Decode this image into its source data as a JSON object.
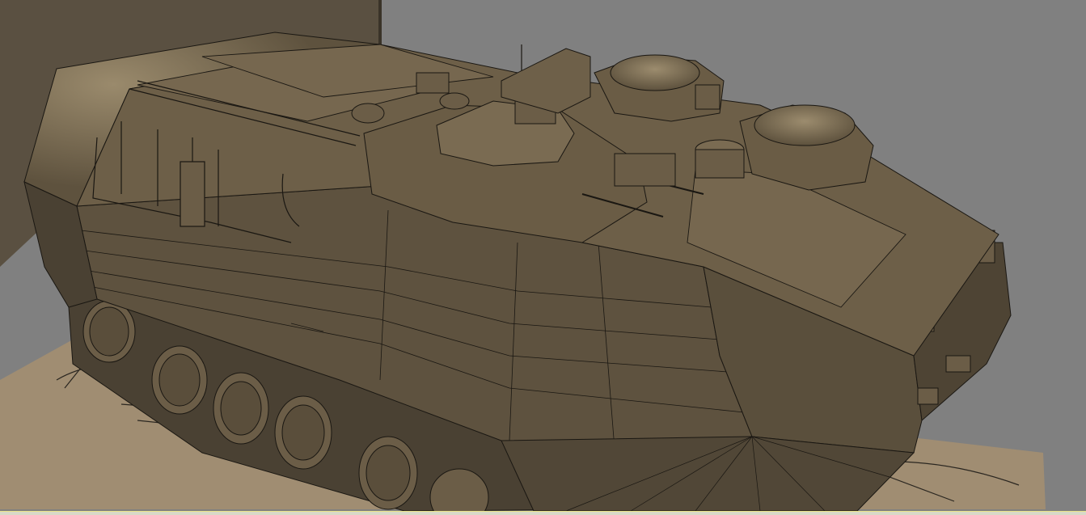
{
  "viewport": {
    "background_color": "#808080",
    "model_color": "#6b5d47",
    "model_shadow_color": "#3f3628",
    "model_highlight_color": "#8d7d61",
    "edge_color": "#1a1712",
    "blueprint_color": "#a08d72",
    "blueprint_line_color": "#2a2620"
  }
}
